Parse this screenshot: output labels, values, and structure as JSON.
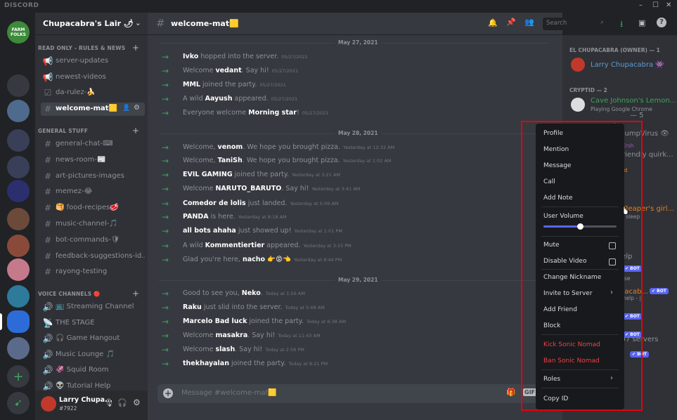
{
  "app": {
    "name": "DISCORD"
  },
  "window_controls": {
    "minimize": "–",
    "maximize": "☐",
    "close": "✕"
  },
  "rail": {
    "servers": [
      {
        "label": "FARM FOLKS",
        "color": "#3c8a3a"
      },
      {
        "label": "",
        "color": "#202225"
      },
      {
        "label": "",
        "color": "#36393f"
      },
      {
        "label": "",
        "color": "#4e6a8c"
      },
      {
        "label": "",
        "color": "#3a3f58"
      },
      {
        "label": "",
        "color": "#3a3f58"
      },
      {
        "label": "",
        "color": "#2c2f6e"
      },
      {
        "label": "",
        "color": "#6b4a3a"
      },
      {
        "label": "",
        "color": "#8a4a3a"
      },
      {
        "label": "",
        "color": "#c47a8a"
      },
      {
        "label": "",
        "color": "#2e7a9a"
      },
      {
        "label": "",
        "color": "#2d6bd8"
      },
      {
        "label": "",
        "color": "#5a6a8a"
      }
    ],
    "add": "+",
    "explore": "➹"
  },
  "guild": {
    "name": "Chupacabra's Lair 🌶",
    "chevron": "⌄"
  },
  "categories": {
    "read_only": "READ ONLY - RULES & NEWS",
    "general": "GENERAL STUFF",
    "voice": "VOICE CHANNELS 🔴"
  },
  "channels": {
    "read_only": [
      {
        "icon": "📢",
        "label": "server-updates"
      },
      {
        "icon": "📢",
        "label": "newest-videos"
      },
      {
        "icon": "☑",
        "label": "da-rulez-🍌"
      },
      {
        "icon": "#",
        "label": "welcome-mat🟨",
        "active": true
      }
    ],
    "general": [
      {
        "icon": "#",
        "label": "general-chat-⌨"
      },
      {
        "icon": "#",
        "label": "news-room-📰"
      },
      {
        "icon": "#",
        "label": "art-pictures-images"
      },
      {
        "icon": "#",
        "label": "memez-😂"
      },
      {
        "icon": "#",
        "label": "🥞 food-recipes🥩"
      },
      {
        "icon": "#",
        "label": "music-channel-🎵"
      },
      {
        "icon": "#",
        "label": "bot-commands-🛡"
      },
      {
        "icon": "#",
        "label": "feedback-suggestions-id..."
      },
      {
        "icon": "#",
        "label": "rayong-testing"
      }
    ],
    "voice": [
      {
        "icon": "🔊",
        "label": "📺 Streaming Channel"
      },
      {
        "icon": "📡",
        "label": "THE STAGE"
      },
      {
        "icon": "🔊",
        "label": "🎧 Game Hangout"
      },
      {
        "icon": "🔊",
        "label": "Music Lounge 🎵"
      },
      {
        "icon": "🔊",
        "label": "🦑 Squid Room"
      },
      {
        "icon": "🔊",
        "label": "👽 Tutorial Help"
      }
    ]
  },
  "user_panel": {
    "name": "Larry Chupa...",
    "tag": "#7922",
    "mic": "🎙",
    "headset": "🎧",
    "settings": "⚙"
  },
  "chat_header": {
    "hash": "#",
    "channel": "welcome-mat🟨",
    "search_placeholder": "Search"
  },
  "dividers": [
    "May 27, 2021",
    "May 28, 2021",
    "May 29, 2021"
  ],
  "messages": [
    {
      "pre": "",
      "name": "Ivko",
      "post": " hopped into the server.",
      "ts": "05/27/2021"
    },
    {
      "pre": "Welcome ",
      "name": "vedant",
      "post": ". Say hi!",
      "ts": "05/27/2021"
    },
    {
      "pre": "",
      "name": "MML",
      "post": " joined the party.",
      "ts": "05/27/2021"
    },
    {
      "pre": "A wild ",
      "name": "Aayush",
      "post": " appeared.",
      "ts": "05/27/2021"
    },
    {
      "pre": "Everyone welcome ",
      "name": "Morning star",
      "post": "!",
      "ts": "05/27/2021"
    },
    {
      "pre": "Welcome, ",
      "name": "venom",
      "post": ". We hope you brought pizza.",
      "ts": "Yesterday at 12:32 AM"
    },
    {
      "pre": "Welcome, ",
      "name": "TaniSh",
      "post": ". We hope you brought pizza.",
      "ts": "Yesterday at 1:02 AM"
    },
    {
      "pre": "",
      "name": "EVIL GAMING",
      "post": " joined the party.",
      "ts": "Yesterday at 3:21 AM"
    },
    {
      "pre": "Welcome ",
      "name": "NARUTO_BARUTO",
      "post": ". Say hi!",
      "ts": "Yesterday at 3:41 AM"
    },
    {
      "pre": "",
      "name": "Comedor de lolis",
      "post": " just landed.",
      "ts": "Yesterday at 5:09 AM"
    },
    {
      "pre": "",
      "name": "PANDA",
      "post": " is here.",
      "ts": "Yesterday at 8:18 AM"
    },
    {
      "pre": "",
      "name": "all bots ahaha",
      "post": " just showed up!",
      "ts": "Yesterday at 1:01 PM"
    },
    {
      "pre": "A wild ",
      "name": "Kommentiertier",
      "post": " appeared.",
      "ts": "Yesterday at 3:15 PM"
    },
    {
      "pre": "Glad you're here, ",
      "name": "nacho 👉😡👈",
      "post": "",
      "ts": "Yesterday at 8:44 PM"
    },
    {
      "pre": "Good to see you, ",
      "name": "Neko",
      "post": ".",
      "ts": "Today at 1:56 AM"
    },
    {
      "pre": "",
      "name": "Raku",
      "post": " just slid into the server.",
      "ts": "Today at 5:48 AM"
    },
    {
      "pre": "",
      "name": "Marcelo Bad luck",
      "post": " joined the party.",
      "ts": "Today at 6:38 AM"
    },
    {
      "pre": "Welcome ",
      "name": "masakra",
      "post": ". Say hi!",
      "ts": "Today at 11:43 AM"
    },
    {
      "pre": "Welcome ",
      "name": "slash",
      "post": ". Say hi!",
      "ts": "Today at 2:58 PM"
    },
    {
      "pre": "",
      "name": "thekhayalan",
      "post": " joined the party.",
      "ts": "Today at 8:21 PM"
    }
  ],
  "composer": {
    "placeholder": "Message #welcome-mat🟨",
    "plus": "+"
  },
  "members": {
    "owner_cat": "EL CHUPACABRA (OWNER) — 1",
    "owner_name": "Larry Chupacabra 👾",
    "cryptid_cat": "CRYPTID — 2",
    "cryptid_name": "Cave Johnson's Lemon...",
    "cryptid_sub": "Playing Google Chrome",
    "partial": [
      {
        "text": "— 5",
        "color": "#8e9297"
      },
      {
        "text": "n",
        "color": "#3ba55d"
      },
      {
        "text": "/SlumpVirus 👁",
        "color": "#8e9297"
      },
      {
        "text": "ter Ersh",
        "color": "#9b59b6"
      },
      {
        "text": "ur friendly quirk...",
        "color": "#8e9297"
      },
      {
        "text": "ad",
        "color": "#e67e22"
      },
      {
        "text": "Reaper's girl...",
        "color": "#e67e22"
      },
      {
        "text": "ur sleep",
        "color": "#8e9297"
      },
      {
        "text": "| ?help",
        "color": "#8e9297"
      },
      {
        "text": "se",
        "color": "#8e9297"
      },
      {
        "text": "pacab...",
        "color": "#e67e22"
      },
      {
        "text": "tube, ?help - |",
        "color": "#8e9297"
      },
      {
        "text": ",007 servers",
        "color": "#8e9297"
      },
      {
        "text": "Pl...",
        "color": "#8e9297"
      }
    ],
    "bot_badge": "✔ BOT"
  },
  "context_menu": {
    "items": [
      "Profile",
      "Mention",
      "Message",
      "Call",
      "Add Note"
    ],
    "user_volume": {
      "label": "User Volume",
      "value": 0.5
    },
    "toggles": [
      "Mute",
      "Disable Video"
    ],
    "items2": [
      "Change Nickname",
      "Invite to Server",
      "Add Friend",
      "Block"
    ],
    "danger": [
      "Kick Sonic Nomad",
      "Ban Sonic Nomad"
    ],
    "roles": "Roles",
    "copy_id": "Copy ID",
    "submenu_arrow": "›"
  },
  "colors": {
    "accent": "#5865f2",
    "green": "#3ba55d",
    "danger": "#ed4245",
    "highlight_box": "#e8000d"
  }
}
